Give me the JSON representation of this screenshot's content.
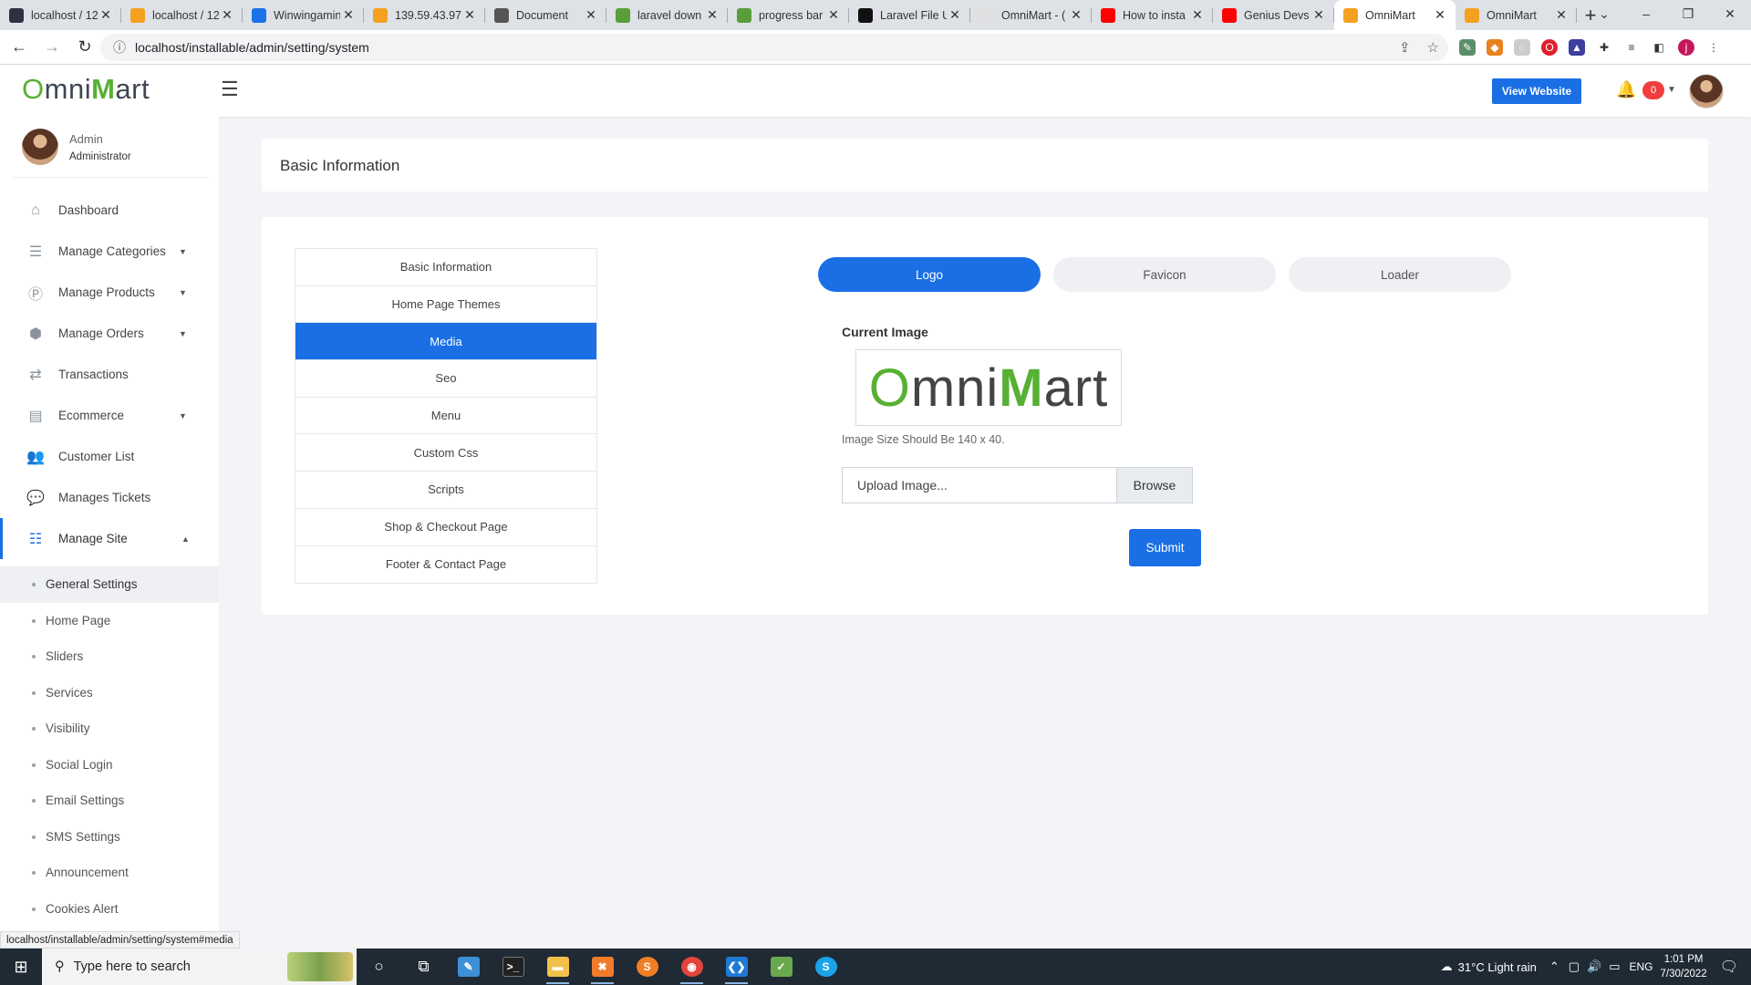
{
  "browser": {
    "tabs": [
      {
        "title": "localhost / 12",
        "icon_color": "#2d3142",
        "icon": "db-icon"
      },
      {
        "title": "localhost / 12",
        "icon_color": "#f4a11f",
        "icon": "pma-icon"
      },
      {
        "title": "Winwingamin",
        "icon_color": "#1a73e8",
        "icon": "discord-icon"
      },
      {
        "title": "139.59.43.97",
        "icon_color": "#f4a11f",
        "icon": "pma-icon"
      },
      {
        "title": "Document",
        "icon_color": "#555555",
        "icon": "globe-icon"
      },
      {
        "title": "laravel down",
        "icon_color": "#5a9e3a",
        "icon": "y-icon"
      },
      {
        "title": "progress bar",
        "icon_color": "#5a9e3a",
        "icon": "y-icon"
      },
      {
        "title": "Laravel File U",
        "icon_color": "#111111",
        "icon": "gh-icon"
      },
      {
        "title": "OmniMart - (",
        "icon_color": "#e0e0e0",
        "icon": "omni-icon"
      },
      {
        "title": "How to insta",
        "icon_color": "#ff0000",
        "icon": "youtube-icon"
      },
      {
        "title": "Genius Devs",
        "icon_color": "#ff0000",
        "icon": "youtube-icon"
      },
      {
        "title": "OmniMart",
        "icon_color": "#f4a11f",
        "icon": "bag-icon",
        "active": true
      },
      {
        "title": "OmniMart",
        "icon_color": "#f4a11f",
        "icon": "bag-icon"
      }
    ],
    "url": "localhost/installable/admin/setting/system",
    "status_url": "localhost/installable/admin/setting/system#media"
  },
  "header": {
    "logo_o": "O",
    "logo_mid": "mni",
    "logo_m": "M",
    "logo_end": "art",
    "view_website": "View Website",
    "notif_count": "0"
  },
  "sidebar": {
    "user_name": "Admin",
    "user_role": "Administrator",
    "items": [
      {
        "label": "Dashboard",
        "icon": "home-icon",
        "glyph": "⌂"
      },
      {
        "label": "Manage Categories",
        "icon": "list-icon",
        "glyph": "☰",
        "dropdown": true
      },
      {
        "label": "Manage Products",
        "icon": "product-icon",
        "glyph": "Ⓟ",
        "dropdown": true
      },
      {
        "label": "Manage Orders",
        "icon": "orders-icon",
        "glyph": "⬢",
        "dropdown": true
      },
      {
        "label": "Transactions",
        "icon": "shuffle-icon",
        "glyph": "⇄"
      },
      {
        "label": "Ecommerce",
        "icon": "table-icon",
        "glyph": "▤",
        "dropdown": true
      },
      {
        "label": "Customer List",
        "icon": "users-icon",
        "glyph": "👥"
      },
      {
        "label": "Manages Tickets",
        "icon": "chat-icon",
        "glyph": "💬"
      },
      {
        "label": "Manage Site",
        "icon": "tasks-icon",
        "glyph": "☷",
        "dropdown": true,
        "open": true
      }
    ],
    "subitems": [
      {
        "label": "General Settings",
        "active": true
      },
      {
        "label": "Home Page"
      },
      {
        "label": "Sliders"
      },
      {
        "label": "Services"
      },
      {
        "label": "Visibility"
      },
      {
        "label": "Social Login"
      },
      {
        "label": "Email Settings"
      },
      {
        "label": "SMS Settings"
      },
      {
        "label": "Announcement"
      },
      {
        "label": "Cookies Alert"
      }
    ]
  },
  "page": {
    "title": "Basic Information",
    "settings_tabs": [
      {
        "label": "Basic Information"
      },
      {
        "label": "Home Page Themes"
      },
      {
        "label": "Media",
        "active": true
      },
      {
        "label": "Seo"
      },
      {
        "label": "Menu"
      },
      {
        "label": "Custom Css"
      },
      {
        "label": "Scripts"
      },
      {
        "label": "Shop & Checkout Page"
      },
      {
        "label": "Footer & Contact Page"
      }
    ],
    "media_tabs": [
      {
        "label": "Logo",
        "active": true
      },
      {
        "label": "Favicon"
      },
      {
        "label": "Loader"
      }
    ],
    "current_image_label": "Current Image",
    "image_hint": "Image Size Should Be 140 x 40.",
    "upload_placeholder": "Upload Image...",
    "browse_label": "Browse",
    "submit_label": "Submit"
  },
  "taskbar": {
    "search_placeholder": "Type here to search",
    "weather": "31°C  Light rain",
    "lang": "ENG",
    "time": "1:01 PM",
    "date": "7/30/2022"
  },
  "colors": {
    "accent": "#1a6fe5",
    "brand_green": "#57b033",
    "badge_red": "#f13d3d"
  }
}
